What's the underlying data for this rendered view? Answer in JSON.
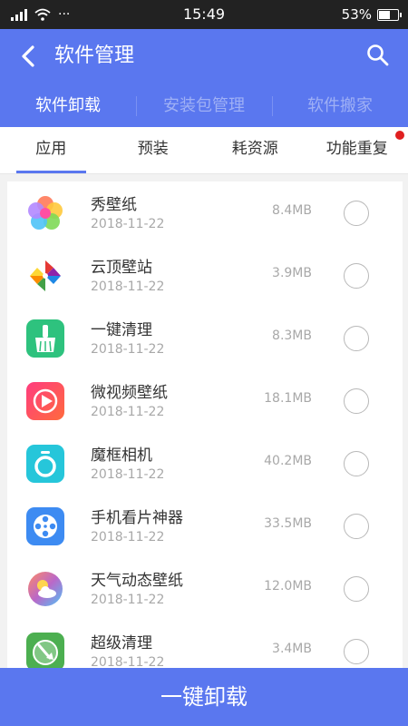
{
  "status": {
    "time": "15:49",
    "battery": "53%",
    "battery_level": 0.53,
    "dots": "···"
  },
  "header": {
    "title": "软件管理"
  },
  "top_tabs": [
    {
      "label": "软件卸载",
      "active": true
    },
    {
      "label": "安装包管理",
      "active": false
    },
    {
      "label": "软件搬家",
      "active": false
    }
  ],
  "sub_tabs": [
    {
      "label": "应用",
      "active": true
    },
    {
      "label": "预装",
      "active": false
    },
    {
      "label": "耗资源",
      "active": false
    },
    {
      "label": "功能重复",
      "active": false,
      "badge": true
    }
  ],
  "apps": [
    {
      "name": "秀壁纸",
      "date": "2018-11-22",
      "size": "8.4MB",
      "icon": "flower-icon"
    },
    {
      "name": "云顶壁站",
      "date": "2018-11-22",
      "size": "3.9MB",
      "icon": "pinwheel-icon"
    },
    {
      "name": "一键清理",
      "date": "2018-11-22",
      "size": "8.3MB",
      "icon": "broom-icon"
    },
    {
      "name": "微视频壁纸",
      "date": "2018-11-22",
      "size": "18.1MB",
      "icon": "play-icon"
    },
    {
      "name": "魔框相机",
      "date": "2018-11-22",
      "size": "40.2MB",
      "icon": "camera-icon"
    },
    {
      "name": "手机看片神器",
      "date": "2018-11-22",
      "size": "33.5MB",
      "icon": "film-reel-icon"
    },
    {
      "name": "天气动态壁纸",
      "date": "2018-11-22",
      "size": "12.0MB",
      "icon": "weather-icon"
    },
    {
      "name": "超级清理",
      "date": "2018-11-22",
      "size": "3.4MB",
      "icon": "super-clean-icon"
    }
  ],
  "action": {
    "uninstall_label": "一键卸载"
  },
  "colors": {
    "accent": "#5a77ef",
    "badge": "#e02020"
  }
}
